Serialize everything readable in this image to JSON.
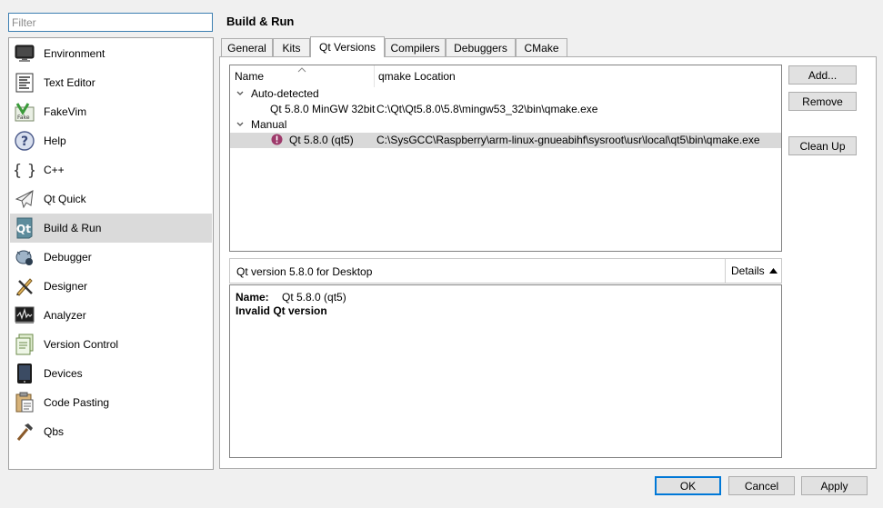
{
  "filter": {
    "placeholder": "Filter"
  },
  "categories": [
    {
      "label": "Environment",
      "icon": "monitor-icon"
    },
    {
      "label": "Text Editor",
      "icon": "text-document-icon"
    },
    {
      "label": "FakeVim",
      "icon": "fakevim-icon"
    },
    {
      "label": "Help",
      "icon": "help-icon"
    },
    {
      "label": "C++",
      "icon": "braces-icon"
    },
    {
      "label": "Qt Quick",
      "icon": "paper-plane-icon"
    },
    {
      "label": "Build & Run",
      "icon": "qt-build-icon",
      "selected": true
    },
    {
      "label": "Debugger",
      "icon": "bug-icon"
    },
    {
      "label": "Designer",
      "icon": "pencil-brush-icon"
    },
    {
      "label": "Analyzer",
      "icon": "oscilloscope-icon"
    },
    {
      "label": "Version Control",
      "icon": "version-control-icon"
    },
    {
      "label": "Devices",
      "icon": "tablet-icon"
    },
    {
      "label": "Code Pasting",
      "icon": "clipboard-icon"
    },
    {
      "label": "Qbs",
      "icon": "hammer-icon"
    }
  ],
  "page": {
    "title": "Build & Run"
  },
  "tabs": [
    {
      "label": "General"
    },
    {
      "label": "Kits"
    },
    {
      "label": "Qt Versions",
      "active": true
    },
    {
      "label": "Compilers"
    },
    {
      "label": "Debuggers"
    },
    {
      "label": "CMake"
    }
  ],
  "tree": {
    "columns": [
      "Name",
      "qmake Location"
    ],
    "groups": [
      {
        "label": "Auto-detected",
        "items": [
          {
            "name": "Qt 5.8.0 MinGW 32bit",
            "location": "C:\\Qt\\Qt5.8.0\\5.8\\mingw53_32\\bin\\qmake.exe",
            "warning": false
          }
        ]
      },
      {
        "label": "Manual",
        "items": [
          {
            "name": "Qt 5.8.0 (qt5)",
            "location": "C:\\SysGCC\\Raspberry\\arm-linux-gnueabihf\\sysroot\\usr\\local\\qt5\\bin\\qmake.exe",
            "warning": true,
            "selected": true
          }
        ]
      }
    ]
  },
  "side_buttons": {
    "add": "Add...",
    "remove": "Remove",
    "clean_up": "Clean Up"
  },
  "details": {
    "summary": "Qt version 5.8.0 for Desktop",
    "toggle_label": "Details",
    "name_label": "Name:",
    "name_value": "Qt 5.8.0 (qt5)",
    "status": "Invalid Qt version"
  },
  "dialog_buttons": {
    "ok": "OK",
    "cancel": "Cancel",
    "apply": "Apply"
  },
  "colors": {
    "accent": "#0078d7",
    "selection": "#d9d9d9",
    "warning": "#9e3a6b"
  }
}
